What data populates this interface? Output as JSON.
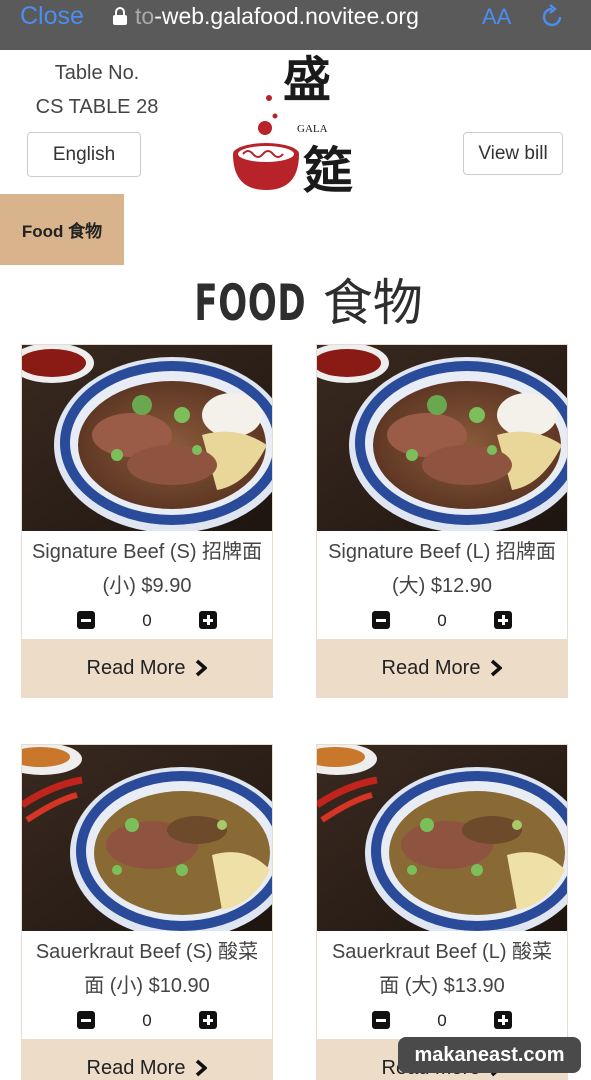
{
  "browser": {
    "close_label": "Close",
    "url_faded": "to",
    "url_main": "-web.galafood.novitee.org",
    "text_size_label": "AA"
  },
  "header": {
    "table_label": "Table No.",
    "table_number": "CS TABLE 28",
    "language_button": "English",
    "view_bill_button": "View bill",
    "logo": {
      "brand_text": "GALA",
      "chinese_top": "盛",
      "chinese_bottom": "筵"
    }
  },
  "category_tab": "Food 食物",
  "section_title": {
    "latin": "FOOD",
    "chinese": "食物"
  },
  "items": [
    {
      "name": "Signature Beef (S) 招牌面 (小) $9.90",
      "qty": "0",
      "read_more": "Read More"
    },
    {
      "name": "Signature Beef (L) 招牌面 (大) $12.90",
      "qty": "0",
      "read_more": "Read More"
    },
    {
      "name": "Sauerkraut Beef (S) 酸菜面 (小) $10.90",
      "qty": "0",
      "read_more": "Read More"
    },
    {
      "name": "Sauerkraut Beef (L) 酸菜面 (大) $13.90",
      "qty": "0",
      "read_more": "Read More"
    }
  ],
  "watermark": "makaneast.com",
  "colors": {
    "browser_bar": "#5a5a5a",
    "browser_accent": "#4a8ef0",
    "category_tab": "#d9b38c",
    "read_more_bg": "#ecdcc8",
    "logo_red": "#b8232a"
  }
}
